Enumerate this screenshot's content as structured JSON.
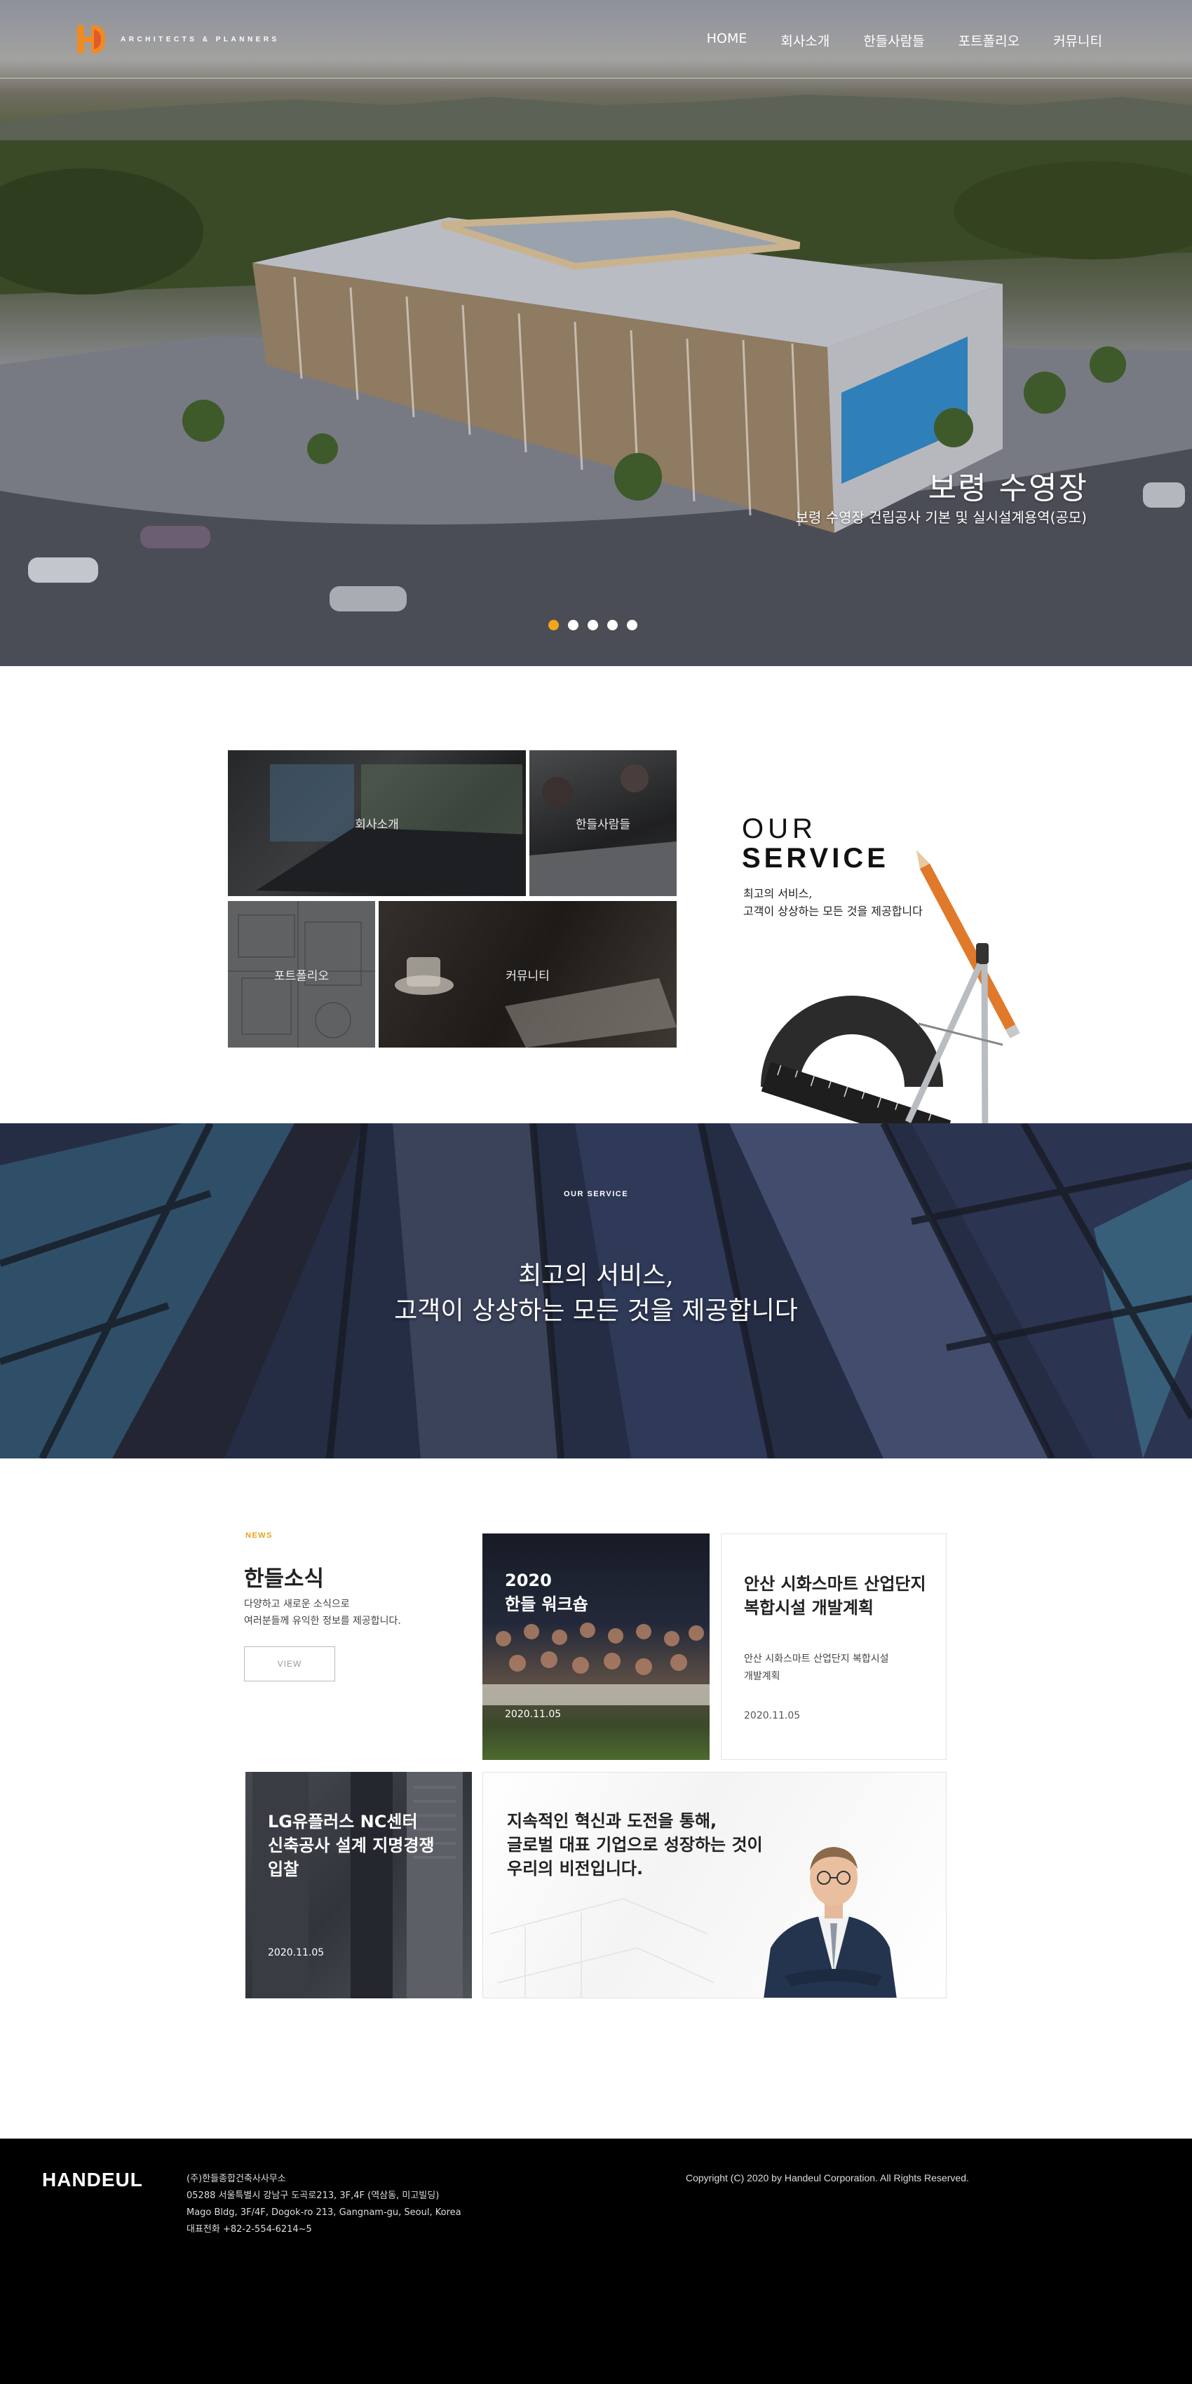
{
  "header": {
    "logo_text": "ARCHITECTS & PLANNERS",
    "nav": [
      "HOME",
      "회사소개",
      "한들사람들",
      "포트폴리오",
      "커뮤니티"
    ]
  },
  "hero": {
    "title": "보령 수영장",
    "subtitle": "보령 수영장 건립공사 기본 및 실시설계용역(공모)",
    "slide_count": 5,
    "active_slide": 1,
    "active_color": "#f2a619"
  },
  "services": {
    "tiles": [
      "회사소개",
      "한들사람들",
      "포트폴리오",
      "커뮤니티"
    ],
    "heading_line1": "OUR",
    "heading_line2": "SERVICE",
    "desc_line1": "최고의 서비스,",
    "desc_line2": "고객이 상상하는 모든 것을 제공합니다"
  },
  "banner": {
    "tag": "OUR SERVICE",
    "line1": "최고의 서비스,",
    "line2": "고객이 상상하는 모든 것을 제공합니다"
  },
  "news": {
    "tag": "NEWS",
    "title": "한들소식",
    "desc_line1": "다양하고 새로운 소식으로",
    "desc_line2": "여러분들께 유익한 정보를 제공합니다.",
    "view_label": "VIEW",
    "accent": "#e8a21a",
    "cards": [
      {
        "title_line1": "2020",
        "title_line2": "한들 워크숍",
        "date": "2020.11.05"
      },
      {
        "title_line1": "안산 시화스마트 산업단지",
        "title_line2": "복합시설 개발계획",
        "summary_line1": "안산 시화스마트 산업단지 복합시설",
        "summary_line2": "개발계획",
        "date": "2020.11.05"
      },
      {
        "title_line1": "LG유플러스 NC센터",
        "title_line2": "신축공사 설계 지명경쟁",
        "title_line3": "입찰",
        "date": "2020.11.05"
      }
    ],
    "vision": {
      "line1": "지속적인 혁신과 도전을 통해,",
      "line2": "글로벌 대표 기업으로 성장하는 것이",
      "line3": "우리의 비전입니다."
    }
  },
  "footer": {
    "brand": "HANDEUL",
    "company": "(주)한들종합건축사사무소",
    "address_kr": "05288 서울특별시 강남구 도곡로213, 3F,4F (역삼동, 미고빌딩)",
    "address_en": "Mago Bldg, 3F/4F, Dogok-ro 213, Gangnam-gu, Seoul, Korea",
    "phone": "대표전화 +82-2-554-6214~5",
    "copyright": "Copyright (C) 2020 by Handeul Corporation. All Rights Reserved."
  }
}
